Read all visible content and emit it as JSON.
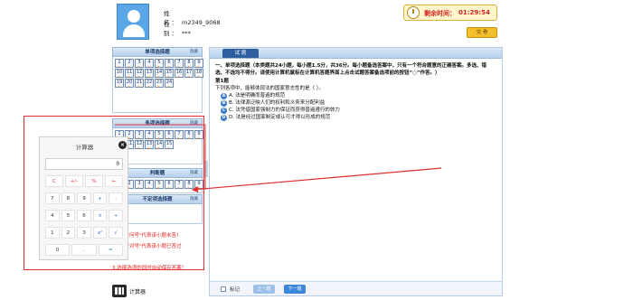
{
  "candidate": {
    "name_label": "姓  名：",
    "name_value": "m2349_9068",
    "id_label": "性  别：",
    "id_value": "***"
  },
  "timer": {
    "label": "剩余时间：",
    "value": "01:29:54"
  },
  "submit_label": "交 卷",
  "sections": [
    {
      "title": "单项选择题",
      "tag": "隐藏",
      "numbers": [
        "1",
        "2",
        "3",
        "4",
        "5",
        "6",
        "7",
        "8",
        "9",
        "10",
        "11",
        "12",
        "13",
        "14",
        "15",
        "16",
        "17",
        "18",
        "19",
        "20",
        "21",
        "22",
        "23",
        "24"
      ]
    },
    {
      "title": "多项选择题",
      "tag": "隐藏",
      "numbers": [
        "1",
        "2",
        "3",
        "4",
        "5",
        "6",
        "7",
        "8",
        "9",
        "10",
        "11",
        "12",
        "13",
        "14",
        "15"
      ]
    },
    {
      "title": "判断题",
      "tag": "隐藏",
      "numbers": [
        "1",
        "2",
        "3",
        "4",
        "5",
        "6",
        "7",
        "8",
        "9",
        "10"
      ]
    },
    {
      "title": "不定项选择题",
      "tag": "隐藏"
    }
  ],
  "question_panel": {
    "tab_label": "试  题",
    "instructions": "一、单项选择题（本类题共24小题，每小题1.5分，共36分。每小题备选答案中，只有一个符合题意的正确答案。多选、错选、不选均不得分。请使用计算机鼠标在计算机答题界面上点击试题答案备选项前的按钮“○”作答。）",
    "question_number": "第1题",
    "question_text": "下列各项中，能够体现法的国家意志性的是（    ）。",
    "options": [
      {
        "letter": "A",
        "text": "A. 法是明确而普遍的规范"
      },
      {
        "letter": "B",
        "text": "B. 法律源泛映人们的权利和义务来分配利益"
      },
      {
        "letter": "C",
        "text": "C. 法凭借国家强制力的保证而获得普遍遵行的效力"
      },
      {
        "letter": "D",
        "text": "D. 法是经过国家制定或认可才得以形成的规范"
      }
    ],
    "mark_label": "标记",
    "prev_label": "上一题",
    "next_label": "下一题"
  },
  "calculator": {
    "title": "计算器",
    "display": "0",
    "keys": [
      "C",
      "+/-",
      "%",
      "←",
      "7",
      "8",
      "9",
      "+",
      "-",
      "4",
      "5",
      "6",
      "×",
      "÷",
      "1",
      "2",
      "3",
      "x²",
      "√",
      "0",
      ".",
      "="
    ]
  },
  "hints": [
    "下方的\"问号\"代表该小题未答！",
    "下方的\"对号\"代表该小题已答过",
    "已！",
    "3.选择选项的同时自动保存答案！"
  ],
  "calc_launch_label": "计算器",
  "colors": {
    "header_blue": "#2d5f9e",
    "annotation_red": "#e03030",
    "timer_red": "#d42020"
  }
}
